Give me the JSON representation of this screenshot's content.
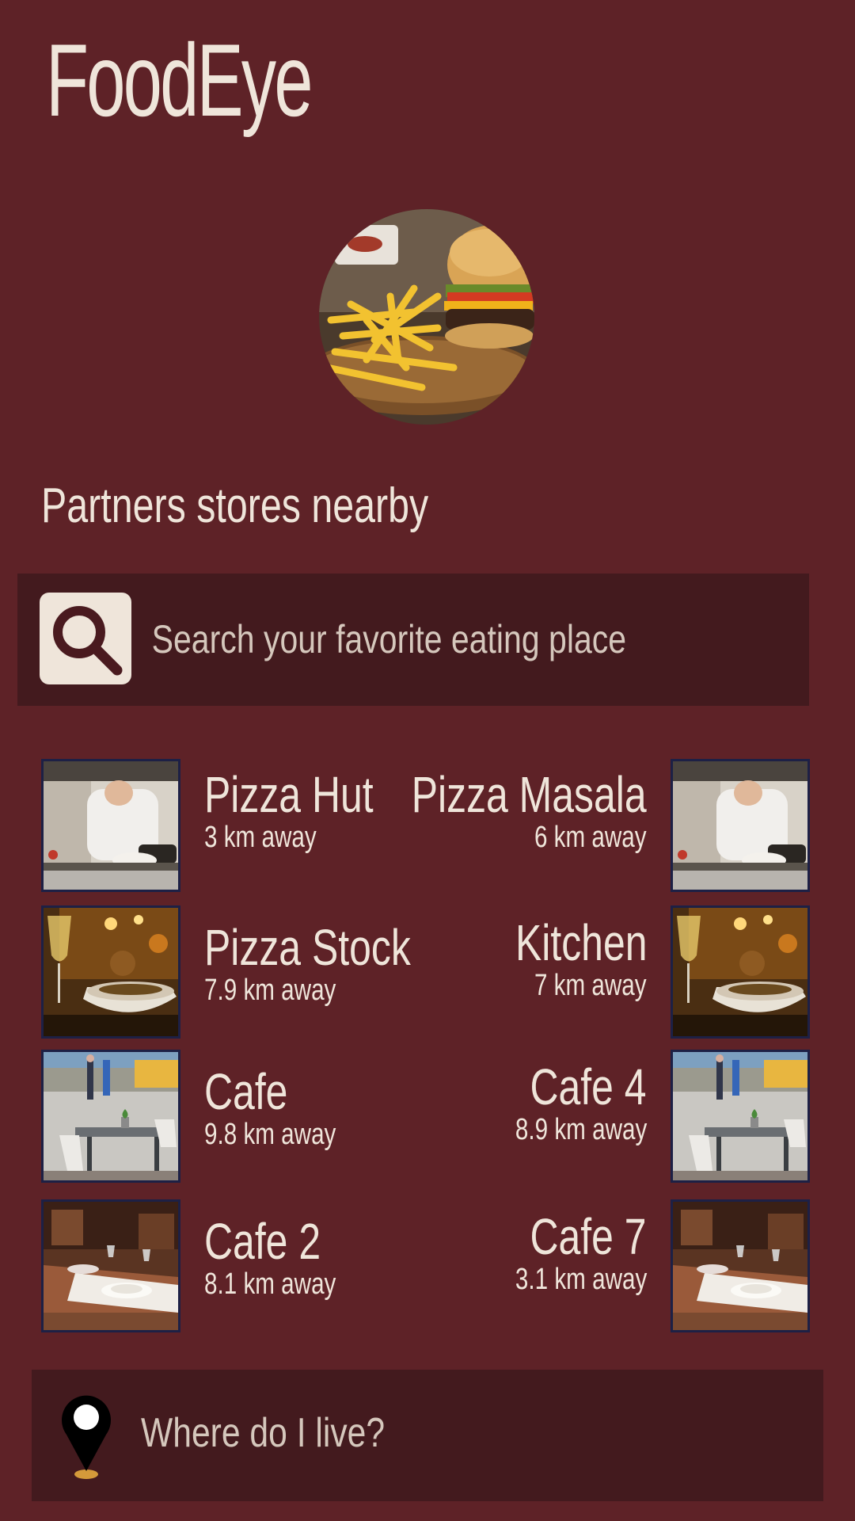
{
  "app": {
    "title": "FoodEye"
  },
  "hero": {
    "image": "burger-and-fries-photo"
  },
  "section": {
    "title": "Partners stores nearby"
  },
  "search": {
    "placeholder": "Search your favorite eating place",
    "icon": "search-icon"
  },
  "stores": [
    {
      "name": "Pizza Hut",
      "distance": "3 km away",
      "thumb": "kitchen-chef-photo"
    },
    {
      "name": "Pizza Masala",
      "distance": "6 km away",
      "thumb": "kitchen-chef-photo"
    },
    {
      "name": "Pizza Stock",
      "distance": "7.9 km away",
      "thumb": "wine-restaurant-photo"
    },
    {
      "name": "Kitchen",
      "distance": "7 km away",
      "thumb": "wine-restaurant-photo"
    },
    {
      "name": "Cafe",
      "distance": "9.8 km away",
      "thumb": "street-cafe-photo"
    },
    {
      "name": "Cafe 4",
      "distance": "8.9 km away",
      "thumb": "street-cafe-photo"
    },
    {
      "name": "Cafe 2",
      "distance": "8.1 km away",
      "thumb": "dining-table-photo"
    },
    {
      "name": "Cafe 7",
      "distance": "3.1 km away",
      "thumb": "dining-table-photo"
    }
  ],
  "location": {
    "label": "Where do I live?",
    "icon": "location-pin-icon"
  },
  "colors": {
    "background": "#5e2227",
    "panel": "#431a1e",
    "text": "#efe5da",
    "thumb_border": "#1d2045",
    "pin_accent": "#d49a3a"
  }
}
